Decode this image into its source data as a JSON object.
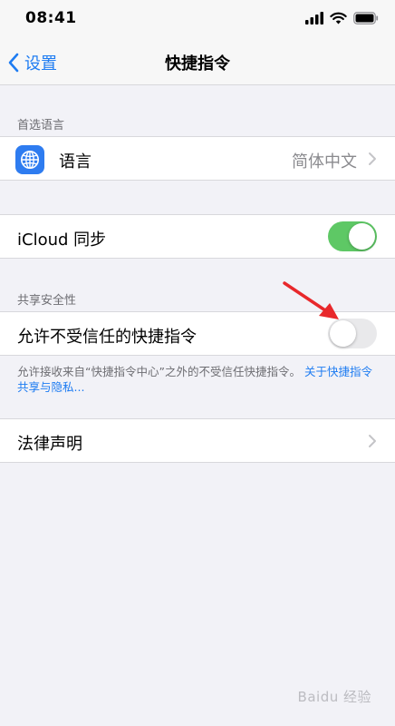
{
  "status_bar": {
    "time": "08:41"
  },
  "nav": {
    "back_label": "设置",
    "title": "快捷指令"
  },
  "sections": {
    "preferred_language_header": "首选语言",
    "sharing_security_header": "共享安全性"
  },
  "language_row": {
    "label": "语言",
    "value": "简体中文",
    "icon": "globe-icon"
  },
  "icloud_row": {
    "label": "iCloud 同步",
    "toggle_on": true
  },
  "untrusted_row": {
    "label": "允许不受信任的快捷指令",
    "toggle_on": false
  },
  "footer": {
    "note": "允许接收来自“快捷指令中心”之外的不受信任快捷指令。",
    "link": "关于快捷指令共享与隐私..."
  },
  "legal_row": {
    "label": "法律声明"
  },
  "colors": {
    "accent": "#1e7cf2",
    "toggle_on": "#5ec865",
    "toggle_off": "#e9e9eb",
    "annotation": "#e8282b"
  },
  "watermark": "Baidu 经验"
}
